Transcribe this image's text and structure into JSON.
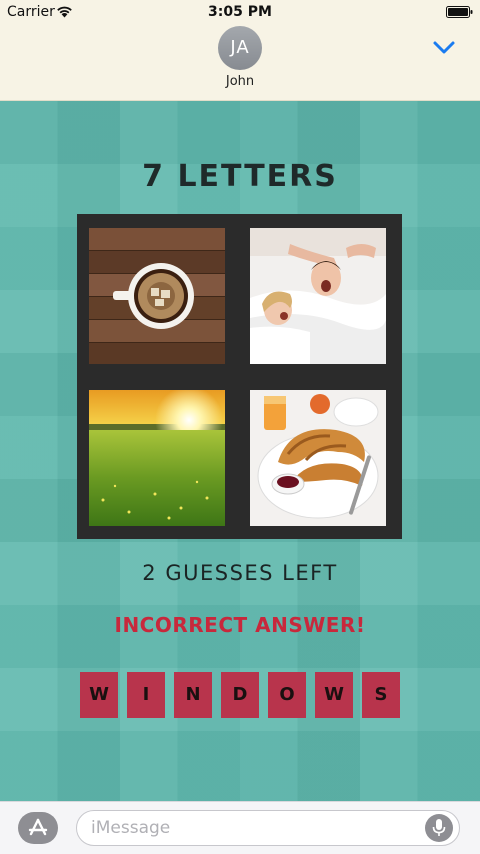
{
  "status_bar": {
    "carrier": "Carrier",
    "time": "3:05 PM",
    "wifi_icon": "wifi-icon",
    "battery_icon": "battery-icon"
  },
  "conversation": {
    "avatar_initials": "JA",
    "contact_name": "John",
    "collapse_icon": "chevron-down-icon",
    "accent_color": "#1a7bf0"
  },
  "game": {
    "letters_label": "7 LETTERS",
    "pictures": [
      {
        "subject": "coffee-cup-icon"
      },
      {
        "subject": "couple-waking-icon"
      },
      {
        "subject": "sunrise-field-icon"
      },
      {
        "subject": "breakfast-croissant-icon"
      }
    ],
    "guesses_left": "2 GUESSES LEFT",
    "feedback": "INCORRECT ANSWER!",
    "answer_letters": [
      "W",
      "I",
      "N",
      "D",
      "O",
      "W",
      "S"
    ],
    "tile_color": "#b8344c",
    "feedback_color": "#c8283c"
  },
  "compose": {
    "appstore_icon": "app-store-icon",
    "placeholder": "iMessage",
    "mic_icon": "microphone-icon"
  }
}
